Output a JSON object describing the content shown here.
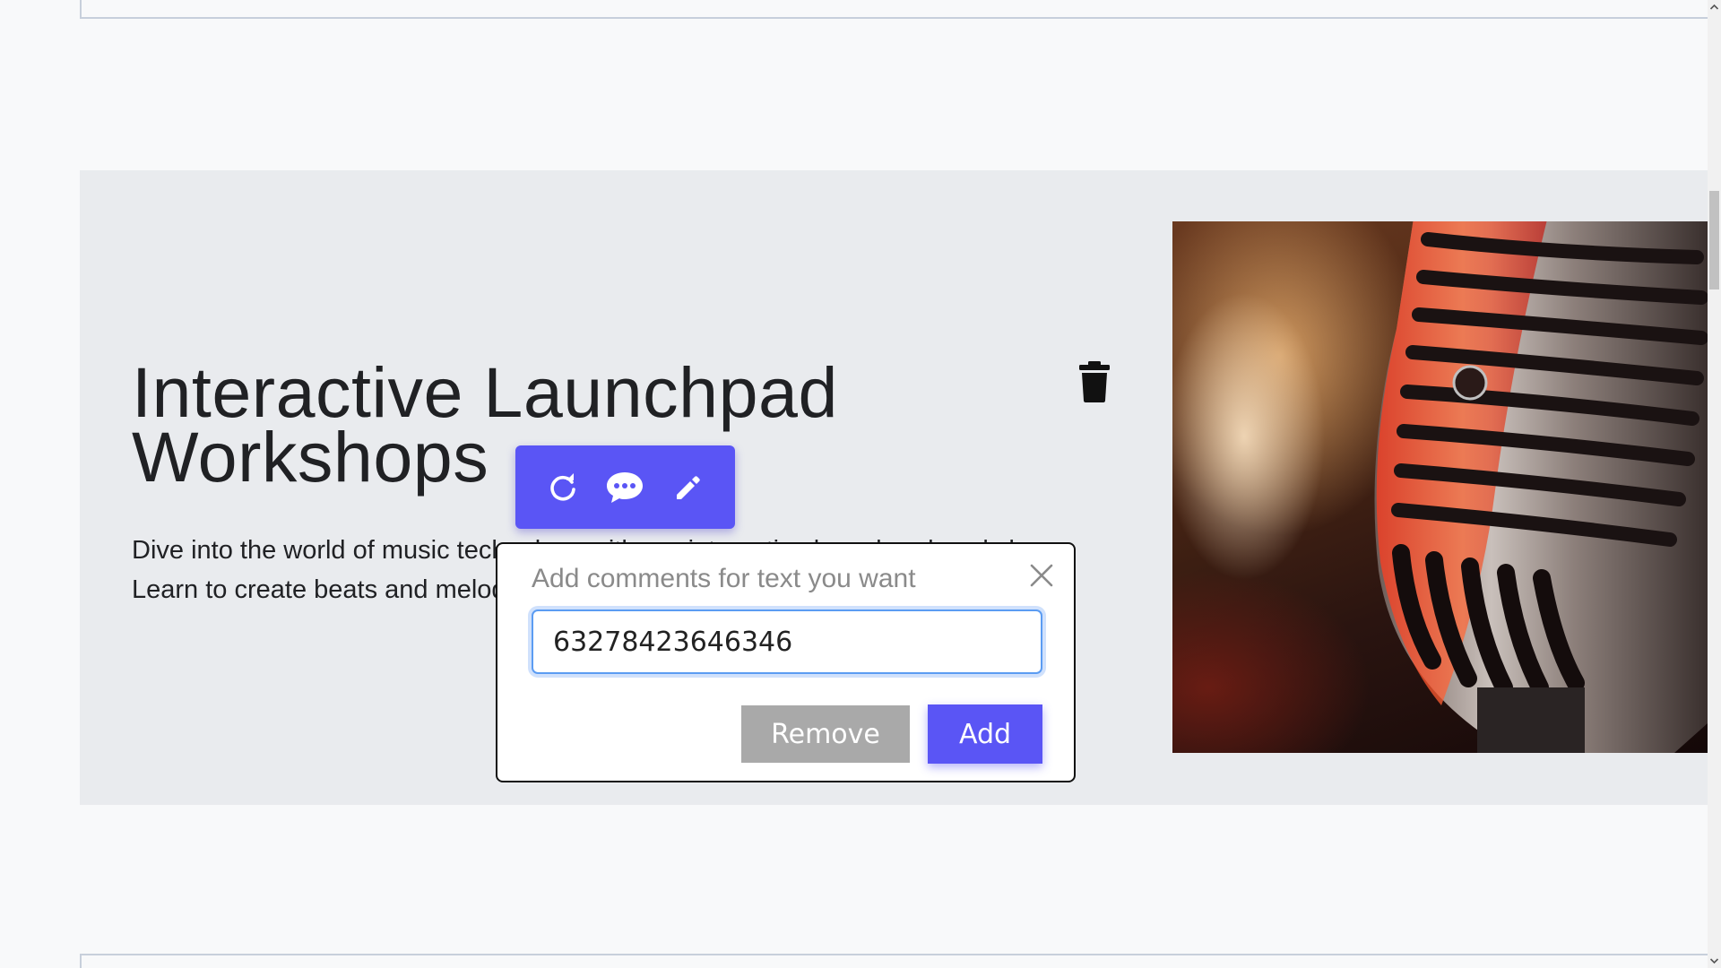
{
  "section": {
    "heading": "Interactive Launchpad Workshops",
    "body_line1": "Dive into the world of music technology with our interactive launchpad workshops.",
    "body_line2": "Learn to create beats and melodies using cutting-edge equipment."
  },
  "toolbar": {
    "icons": [
      "refresh-icon",
      "comment-icon",
      "pencil-icon"
    ],
    "color": "#5a55f5"
  },
  "comment_dialog": {
    "title": "Add comments for text you want",
    "input_value": "63278423646346",
    "remove_label": "Remove",
    "add_label": "Add"
  },
  "colors": {
    "accent": "#5a55f5",
    "section_bg": "#e9ebee",
    "page_bg": "#f8f9fa",
    "remove_bg": "#a9a9a9"
  }
}
